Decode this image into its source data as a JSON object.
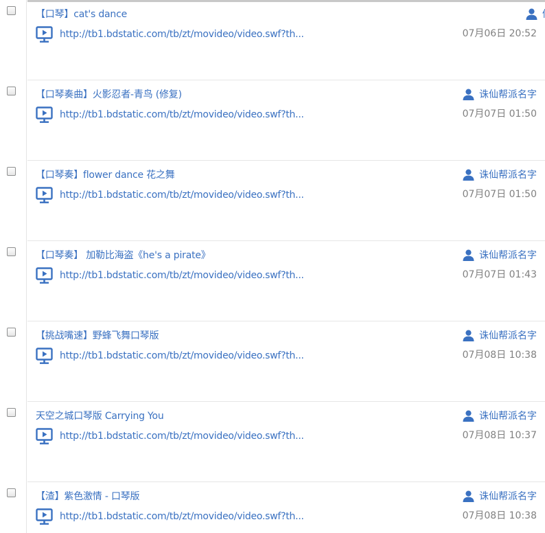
{
  "colors": {
    "link": "#3a71c1",
    "time": "#808080",
    "icon": "#3a71c1",
    "divider": "#e6e6e6"
  },
  "icons": {
    "video": "video-play-icon",
    "user": "user-icon",
    "checkbox": "checkbox"
  },
  "rows": [
    {
      "title": "【口琴】cat's dance",
      "url": "http://tb1.bdstatic.com/tb/zt/movideo/video.swf?th...",
      "author": "俑",
      "time": "07月06日 20:52"
    },
    {
      "title": "【口琴奏曲】火影忍者-青鸟 (修复)",
      "url": "http://tb1.bdstatic.com/tb/zt/movideo/video.swf?th...",
      "author": "诛仙帮派名字",
      "time": "07月07日 01:50"
    },
    {
      "title": "【口琴奏】flower dance 花之舞",
      "url": "http://tb1.bdstatic.com/tb/zt/movideo/video.swf?th...",
      "author": "诛仙帮派名字",
      "time": "07月07日 01:50"
    },
    {
      "title": "【口琴奏】 加勒比海盗《he's a pirate》",
      "url": "http://tb1.bdstatic.com/tb/zt/movideo/video.swf?th...",
      "author": "诛仙帮派名字",
      "time": "07月07日 01:43"
    },
    {
      "title": "【挑战嘴速】野蜂飞舞口琴版",
      "url": "http://tb1.bdstatic.com/tb/zt/movideo/video.swf?th...",
      "author": "诛仙帮派名字",
      "time": "07月08日 10:38"
    },
    {
      "title": "天空之城口琴版 Carrying You",
      "url": "http://tb1.bdstatic.com/tb/zt/movideo/video.swf?th...",
      "author": "诛仙帮派名字",
      "time": "07月08日 10:37"
    },
    {
      "title": "【渣】紫色激情 - 口琴版",
      "url": "http://tb1.bdstatic.com/tb/zt/movideo/video.swf?th...",
      "author": "诛仙帮派名字",
      "time": "07月08日 10:38"
    }
  ]
}
